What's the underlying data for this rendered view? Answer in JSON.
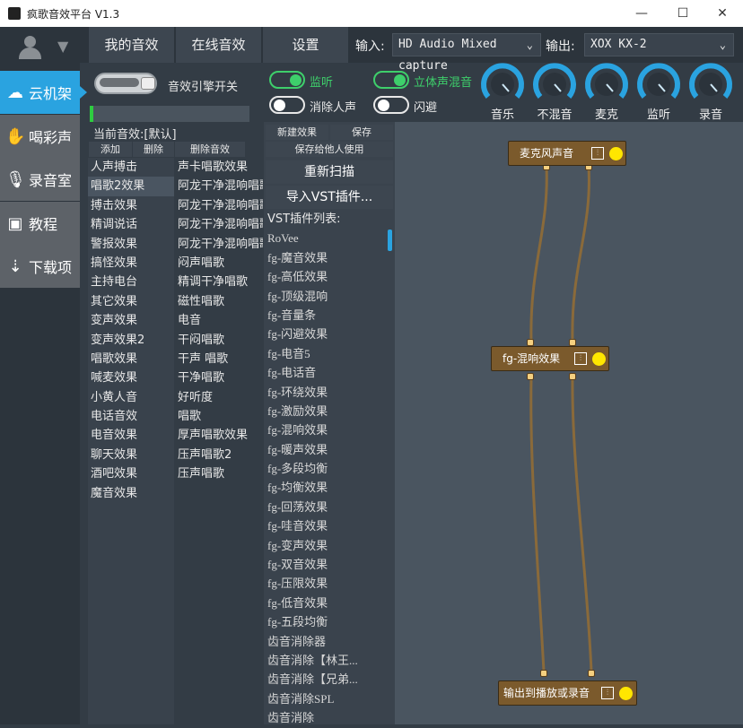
{
  "window": {
    "title": "疯歌音效平台 V1.3"
  },
  "top": {
    "tabs": [
      "我的音效",
      "在线音效",
      "设置"
    ],
    "input_label": "输入:",
    "input_value": "HD Audio Mixed capture",
    "output_label": "输出:",
    "output_value": "XOX KX-2"
  },
  "nav": {
    "items": [
      {
        "label": "云机架",
        "icon": "cloud-icon",
        "active": true
      },
      {
        "label": "喝彩声",
        "icon": "clap-icon"
      },
      {
        "label": "录音室",
        "icon": "microphone-icon"
      },
      {
        "label": "教程",
        "icon": "teacher-icon"
      },
      {
        "label": "下载项",
        "icon": "cloud-download-icon"
      }
    ]
  },
  "engine": {
    "label": "音效引擎开关",
    "level": 0.02
  },
  "current": {
    "label": "当前音效:[默认]",
    "add": "添加",
    "delete": "删除",
    "delete_effect": "删除音效"
  },
  "categories": [
    "人声搏击",
    "唱歌2效果",
    "搏击效果",
    "精调说话",
    "警报效果",
    "搞怪效果",
    "主持电台",
    "其它效果",
    "变声效果",
    "变声效果2",
    "唱歌效果",
    "喊麦效果",
    "小黄人音",
    "电话音效",
    "电音效果",
    "聊天效果",
    "酒吧效果",
    "魔音效果"
  ],
  "presets": [
    "声卡唱歌效果",
    "阿龙干净混响唱歌4",
    "阿龙干净混响唱歌2",
    "阿龙干净混响唱歌3",
    "阿龙干净混响唱歌1",
    "闷声唱歌",
    "精调干净唱歌",
    "磁性唱歌",
    "电音",
    "干闷唱歌",
    "干声 唱歌",
    "干净唱歌",
    "好听度",
    "唱歌",
    "厚声唱歌效果",
    "压声唱歌2",
    "压声唱歌"
  ],
  "toggles": [
    {
      "label": "监听",
      "on": true
    },
    {
      "label": "立体声混音",
      "on": true
    },
    {
      "label": "消除人声",
      "on": false
    },
    {
      "label": "闪避",
      "on": false
    }
  ],
  "vst": {
    "new": "新建效果",
    "save": "保存",
    "save_for_others": "保存给他人使用",
    "rescan": "重新扫描",
    "import": "导入VST插件...",
    "list_title": "VST插件列表:",
    "plugins": [
      "RoVee",
      "fg-魔音效果",
      "fg-高低效果",
      "fg-顶级混响",
      "fg-音量条",
      "fg-闪避效果",
      "fg-电音5",
      "fg-电话音",
      "fg-环绕效果",
      "fg-激励效果",
      "fg-混响效果",
      "fg-暖声效果",
      "fg-多段均衡",
      "fg-均衡效果",
      "fg-回荡效果",
      "fg-哇音效果",
      "fg-变声效果",
      "fg-双音效果",
      "fg-压限效果",
      "fg-低音效果",
      "fg-五段均衡",
      "齿音消除器",
      "齿音消除【林王...",
      "齿音消除【兄弟...",
      "齿音消除SPL",
      "齿音消除"
    ]
  },
  "knobs": [
    "音乐",
    "不混音",
    "麦克",
    "监听",
    "录音"
  ],
  "graph": {
    "nodes": [
      {
        "label": "麦克风声音",
        "cfg": "⫶"
      },
      {
        "label": "fg-混响效果",
        "cfg": "⫶"
      },
      {
        "label": "输出到播放或录音",
        "cfg": "⫶"
      }
    ]
  },
  "colors": {
    "accent": "#2aa3e0",
    "toggle_on": "#3ecf6b",
    "node": "#7b5a2c",
    "led": "#ffe600"
  }
}
